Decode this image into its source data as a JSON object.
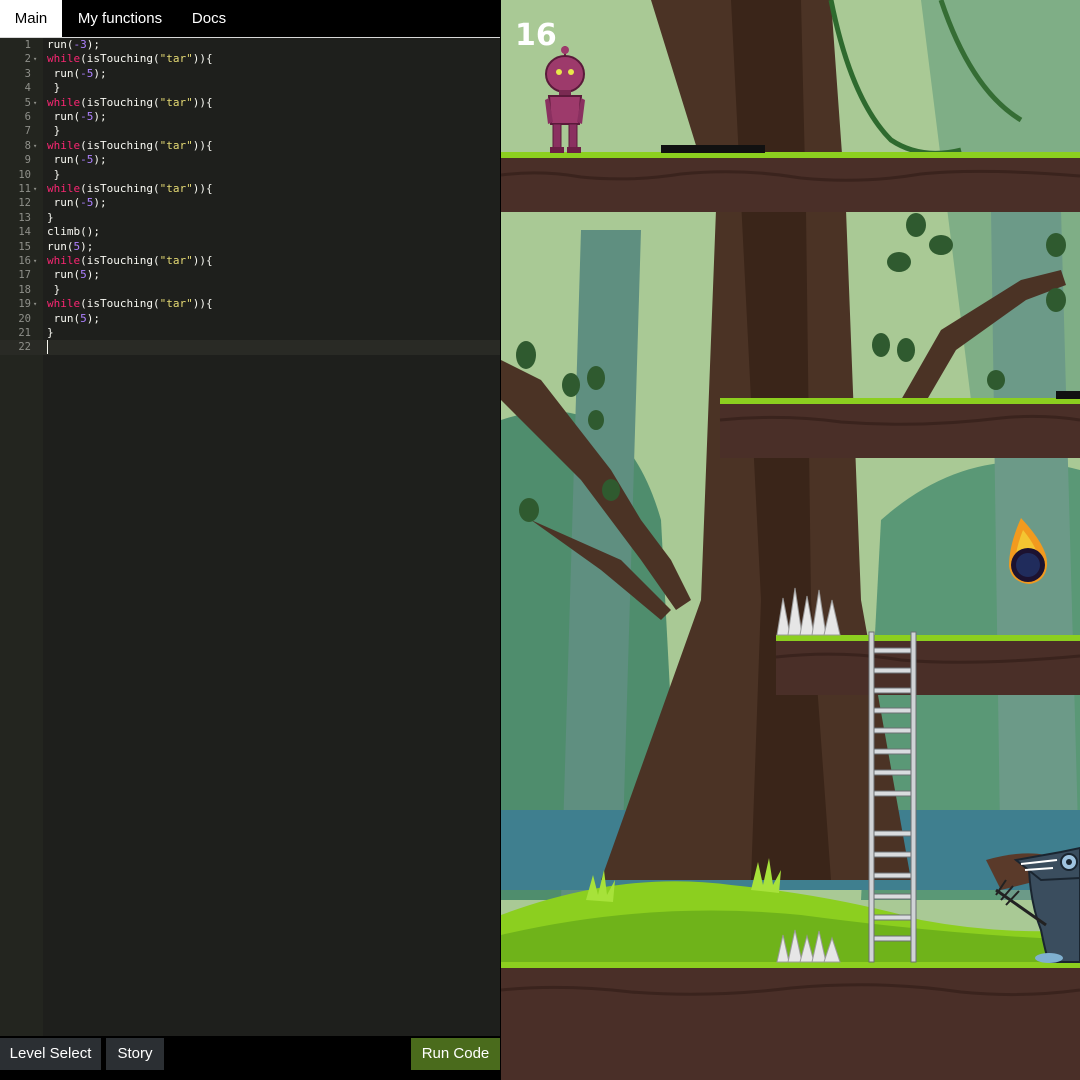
{
  "tabs": [
    {
      "label": "Main",
      "active": true
    },
    {
      "label": "My functions",
      "active": false
    },
    {
      "label": "Docs",
      "active": false
    }
  ],
  "code_lines": [
    [
      [
        "run(",
        "p"
      ],
      [
        "-3",
        "n"
      ],
      [
        ");",
        "p"
      ]
    ],
    [
      [
        "while",
        "k"
      ],
      [
        "(isTouching(",
        "p"
      ],
      [
        "\"tar\"",
        "s"
      ],
      [
        ")){",
        "p"
      ]
    ],
    [
      [
        " run(",
        "p"
      ],
      [
        "-5",
        "n"
      ],
      [
        ");",
        "p"
      ]
    ],
    [
      [
        " }",
        "p"
      ]
    ],
    [
      [
        "while",
        "k"
      ],
      [
        "(isTouching(",
        "p"
      ],
      [
        "\"tar\"",
        "s"
      ],
      [
        ")){",
        "p"
      ]
    ],
    [
      [
        " run(",
        "p"
      ],
      [
        "-5",
        "n"
      ],
      [
        ");",
        "p"
      ]
    ],
    [
      [
        " }",
        "p"
      ]
    ],
    [
      [
        "while",
        "k"
      ],
      [
        "(isTouching(",
        "p"
      ],
      [
        "\"tar\"",
        "s"
      ],
      [
        ")){",
        "p"
      ]
    ],
    [
      [
        " run(",
        "p"
      ],
      [
        "-5",
        "n"
      ],
      [
        ");",
        "p"
      ]
    ],
    [
      [
        " }",
        "p"
      ]
    ],
    [
      [
        "while",
        "k"
      ],
      [
        "(isTouching(",
        "p"
      ],
      [
        "\"tar\"",
        "s"
      ],
      [
        ")){",
        "p"
      ]
    ],
    [
      [
        " run(",
        "p"
      ],
      [
        "-5",
        "n"
      ],
      [
        ");",
        "p"
      ]
    ],
    [
      [
        "}",
        "p"
      ]
    ],
    [
      [
        "climb();",
        "p"
      ]
    ],
    [
      [
        "run(",
        "p"
      ],
      [
        "5",
        "n"
      ],
      [
        ");",
        "p"
      ]
    ],
    [
      [
        "while",
        "k"
      ],
      [
        "(isTouching(",
        "p"
      ],
      [
        "\"tar\"",
        "s"
      ],
      [
        ")){",
        "p"
      ]
    ],
    [
      [
        " run(",
        "p"
      ],
      [
        "5",
        "n"
      ],
      [
        ");",
        "p"
      ]
    ],
    [
      [
        " }",
        "p"
      ]
    ],
    [
      [
        "while",
        "k"
      ],
      [
        "(isTouching(",
        "p"
      ],
      [
        "\"tar\"",
        "s"
      ],
      [
        ")){",
        "p"
      ]
    ],
    [
      [
        " run(",
        "p"
      ],
      [
        "5",
        "n"
      ],
      [
        ");",
        "p"
      ]
    ],
    [
      [
        "}",
        "p"
      ]
    ],
    []
  ],
  "fold_lines": [
    2,
    5,
    8,
    11,
    16,
    19
  ],
  "active_line": 22,
  "bottom": {
    "level_select": "Level Select",
    "story": "Story",
    "run_code": "Run Code"
  },
  "game": {
    "score": "16"
  },
  "colors": {
    "run_button": "#4a6b1c",
    "editor_bg": "#1e1f1c",
    "keyword": "#f92672",
    "number": "#ae81ff",
    "string": "#e6db74"
  }
}
